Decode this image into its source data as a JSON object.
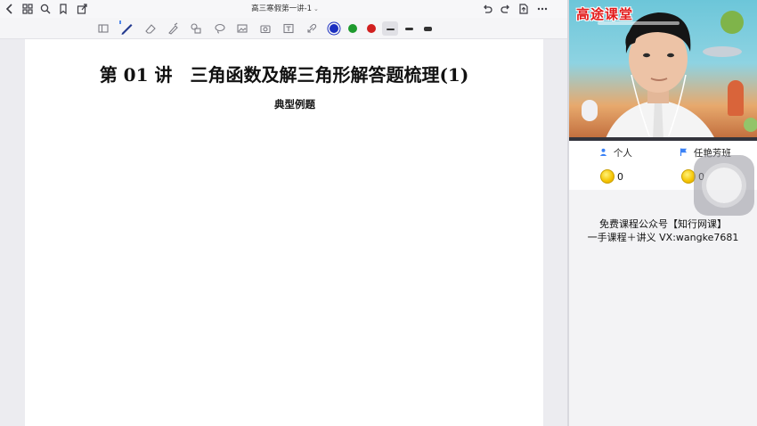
{
  "topbar": {
    "doc_title": "高三寒假第一讲-1",
    "icons": {
      "back": "back-chevron-icon",
      "grid": "grid-icon",
      "search": "search-icon",
      "bookmark": "bookmark-icon",
      "share": "share-icon",
      "undo": "undo-icon",
      "redo": "redo-icon",
      "export": "export-icon",
      "more": "more-icon"
    }
  },
  "toolbar": {
    "tools": [
      "sidebar-toggle",
      "pen",
      "eraser",
      "highlighter",
      "shapes",
      "lasso",
      "image",
      "camera",
      "text",
      "link"
    ],
    "colors": [
      "#1b2fc0",
      "#1e9a2e",
      "#d11f1f"
    ],
    "line_widths": [
      "thin",
      "medium",
      "thick"
    ]
  },
  "page": {
    "heading": "第 01 讲　三角函数及解三角形解答题梳理(1)",
    "subheading": "典型例题"
  },
  "video": {
    "logo": "高途课堂"
  },
  "scores": {
    "personal_label": "个人",
    "class_label": "任艳芳班",
    "personal_value": "0",
    "class_value": "0"
  },
  "promo": {
    "line1": "免费课程公众号【知行网课】",
    "line2": "一手课程＋讲义 VX:wangke7681"
  }
}
